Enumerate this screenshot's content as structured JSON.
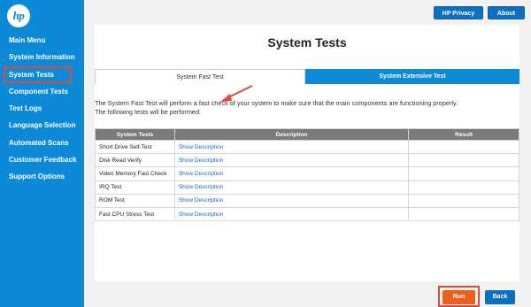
{
  "brand": {
    "logo_text": "hp",
    "accent": "#0c8ad8",
    "highlight": "#e04a3a"
  },
  "sidebar": {
    "items": [
      {
        "label": "Main Menu"
      },
      {
        "label": "System Information"
      },
      {
        "label": "System Tests",
        "active": true
      },
      {
        "label": "Component Tests"
      },
      {
        "label": "Test Logs"
      },
      {
        "label": "Language Selection"
      },
      {
        "label": "Automated Scans"
      },
      {
        "label": "Customer Feedback"
      },
      {
        "label": "Support Options"
      }
    ]
  },
  "topbar": {
    "privacy_label": "HP Privacy",
    "about_label": "About"
  },
  "main": {
    "title": "System Tests",
    "tabs": [
      {
        "label": "System Fast Test",
        "active": true
      },
      {
        "label": "System Extensive Test"
      }
    ],
    "description": "The System Fast Test will perform a fast check of your system to make sure that the main components are functioning properly.",
    "description2": "The following tests will be performed:",
    "table": {
      "headers": [
        "System Tests",
        "Description",
        "Result"
      ],
      "rows": [
        {
          "name": "Short Drive Self-Test",
          "desc": "Show Description",
          "result": ""
        },
        {
          "name": "Disk Read Verify",
          "desc": "Show Description",
          "result": ""
        },
        {
          "name": "Video Memory Fast Check",
          "desc": "Show Description",
          "result": ""
        },
        {
          "name": "IRQ Test",
          "desc": "Show Description",
          "result": ""
        },
        {
          "name": "ROM Test",
          "desc": "Show Description",
          "result": ""
        },
        {
          "name": "Fast CPU Stress Test",
          "desc": "Show Description",
          "result": ""
        }
      ]
    }
  },
  "footer": {
    "run_label": "Run",
    "back_label": "Back"
  }
}
